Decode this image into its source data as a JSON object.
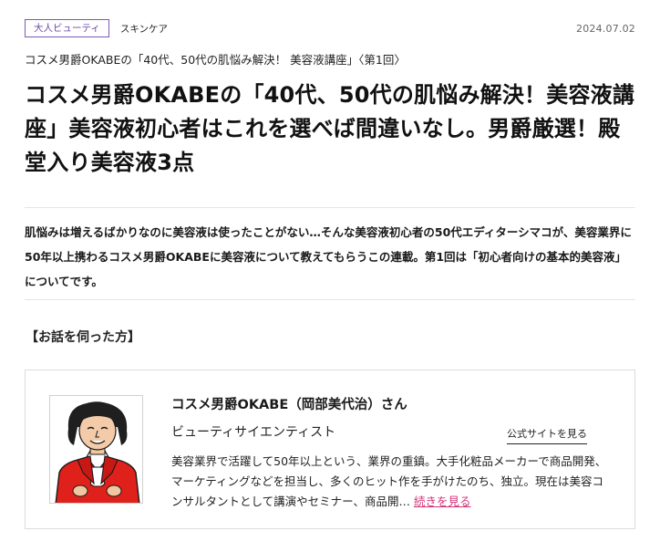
{
  "meta": {
    "category_tag": "大人ビューティ",
    "subcategory": "スキンケア",
    "date": "2024.07.02"
  },
  "article": {
    "series": "コスメ男爵OKABEの「40代、50代の肌悩み解決！ 美容液講座」〈第1回〉",
    "title": "コスメ男爵OKABEの「40代、50代の肌悩み解決！美容液講座」美容液初心者はこれを選べば間違いなし。男爵厳選！殿堂入り美容液3点",
    "lead": "肌悩みは増えるばかりなのに美容液は使ったことがない…そんな美容液初心者の50代エディターシマコが、美容業界に50年以上携わるコスメ男爵OKABEに美容液について教えてもらうこの連載。第1回は「初心者向けの基本的美容液」についてです。"
  },
  "profile": {
    "section_heading": "【お話を伺った方】",
    "name": "コスメ男爵OKABE（岡部美代治）さん",
    "role": "ビューティサイエンティスト",
    "site_link": "公式サイトを見る",
    "bio": "美容業界で活躍して50年以上という、業界の重鎮。大手化粧品メーカーで商品開発、マーケティングなどを担当し、多くのヒット作を手がけたのち、独立。現在は美容コンサルタントとして講演やセミナー、商品開…",
    "read_more": "続きを見る",
    "portrait_icon": "caricature-portrait-icon"
  },
  "colors": {
    "tag_border": "#7b5ab3",
    "link_accent": "#d2347a",
    "jacket_red": "#e0201b"
  }
}
